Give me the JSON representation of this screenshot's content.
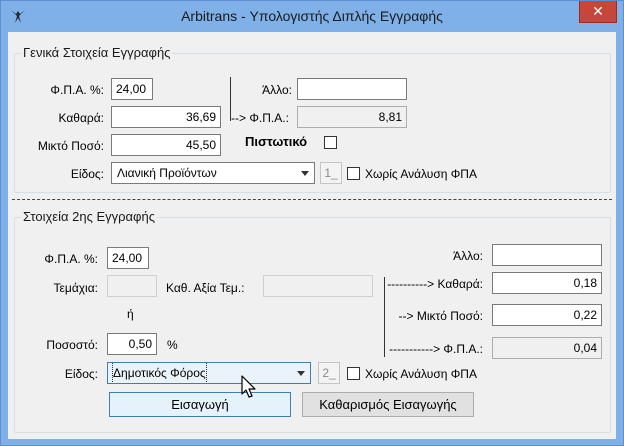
{
  "window": {
    "title": "Arbitrans - Υπολογιστής Διπλής Εγγραφής",
    "close_glyph": "✕"
  },
  "section1": {
    "legend": "Γενικά Στοιχεία Εγγραφής",
    "vat_label": "Φ.Π.Α. %:",
    "vat_value": "24,00",
    "net_label": "Καθαρά:",
    "net_value": "36,69",
    "gross_label": "Μικτό Ποσό:",
    "gross_value": "45,50",
    "other_label": "Άλλο:",
    "other_value": "",
    "vat_amount_label": "--> Φ.Π.Α.:",
    "vat_amount_value": "8,81",
    "credit_label": "Πιστωτικό",
    "type_label": "Είδος:",
    "type_value": "Λιανική Προϊόντων",
    "type_btn": "1_",
    "no_vat_label": "Χωρίς Ανάλυση ΦΠΑ"
  },
  "section2": {
    "legend": "Στοιχεία 2ης Εγγραφής",
    "vat_label": "Φ.Π.Α. %:",
    "vat_value": "24,00",
    "pieces_label": "Τεμάχια:",
    "unit_value_label": "Καθ. Αξία Τεμ.:",
    "or_label": "ή",
    "percent_label": "Ποσοστό:",
    "percent_value": "0,50",
    "percent_sign": "%",
    "type_label": "Είδος:",
    "type_value": "Δημοτικός Φόρος",
    "type_btn": "2_",
    "no_vat_label": "Χωρίς Ανάλυση ΦΠΑ",
    "other_label": "Άλλο:",
    "other_value": "",
    "net_label": "----------> Καθαρά:",
    "net_value": "0,18",
    "gross_label": "--> Μικτό Ποσό:",
    "gross_value": "0,22",
    "vat_amount_label": "-----------> Φ.Π.Α.:",
    "vat_amount_value": "0,04"
  },
  "buttons": {
    "insert": "Εισαγωγή",
    "clear": "Καθαρισμός Εισαγωγής"
  }
}
